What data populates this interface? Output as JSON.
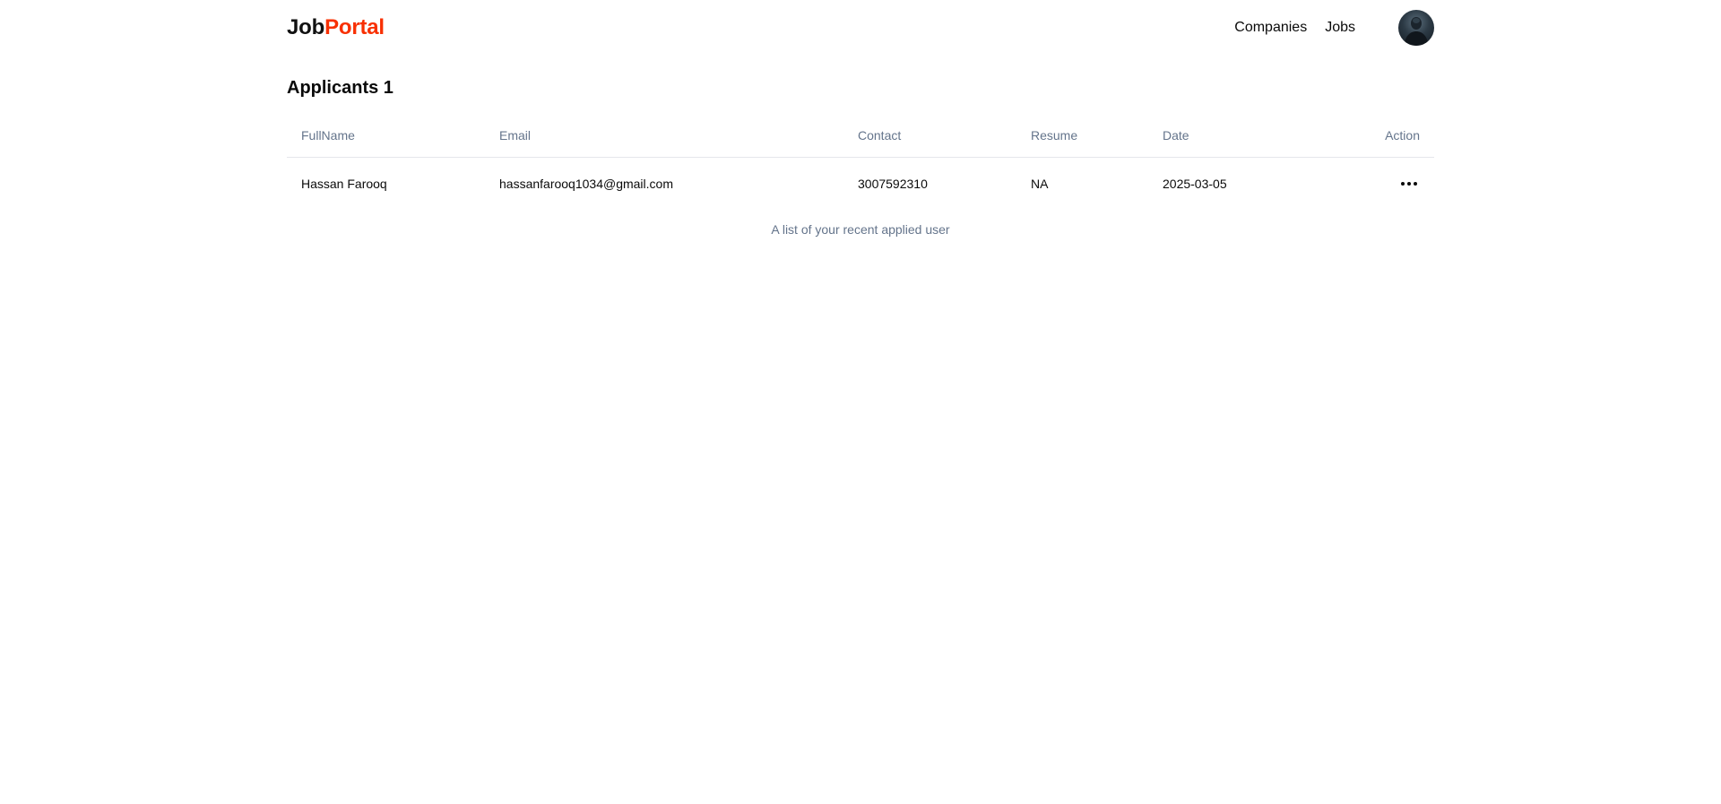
{
  "brand": {
    "part1": "Job",
    "part2": "Portal"
  },
  "nav": {
    "items": [
      {
        "label": "Companies"
      },
      {
        "label": "Jobs"
      }
    ]
  },
  "page": {
    "title": "Applicants 1"
  },
  "table": {
    "headers": {
      "fullname": "FullName",
      "email": "Email",
      "contact": "Contact",
      "resume": "Resume",
      "date": "Date",
      "action": "Action"
    },
    "rows": [
      {
        "fullname": "Hassan Farooq",
        "email": "hassanfarooq1034@gmail.com",
        "contact": "3007592310",
        "resume": "NA",
        "date": "2025-03-05",
        "action_icon": "more-horizontal-icon"
      }
    ],
    "caption": "A list of your recent applied user"
  },
  "colors": {
    "brand_accent": "#f83002",
    "muted_text": "#64748b",
    "border": "#e5e7eb"
  }
}
